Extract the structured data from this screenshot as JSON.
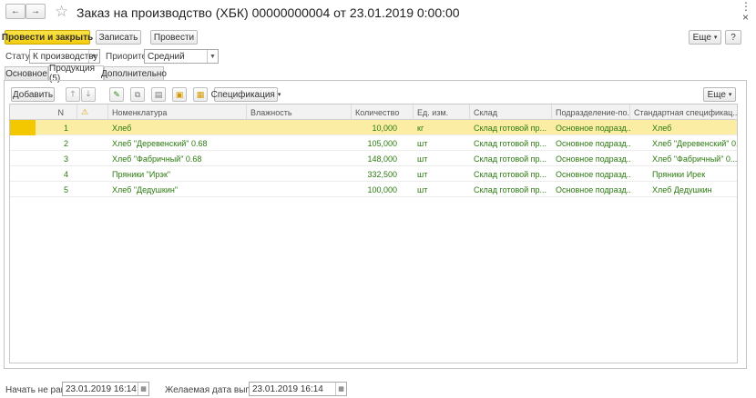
{
  "window": {
    "title": "Заказ на производство (ХБК) 00000000004 от 23.01.2019 0:00:00",
    "more": "⋮",
    "close": "×"
  },
  "nav": {
    "back": "←",
    "forward": "→",
    "star": "☆"
  },
  "toolbar": {
    "post_close": "Провести и закрыть",
    "save": "Записать",
    "post": "Провести",
    "more": "Еще",
    "help": "?"
  },
  "status": {
    "status_label": "Статус:",
    "status_value": "К производству",
    "priority_label": "Приоритет:",
    "priority_value": "Средний"
  },
  "tabs": [
    {
      "label": "Основное"
    },
    {
      "label": "Продукция (5)"
    },
    {
      "label": "Дополнительно"
    }
  ],
  "table_toolbar": {
    "add": "Добавить",
    "spec": "Спецификация",
    "more": "Еще"
  },
  "table": {
    "columns": [
      "N",
      "⚠",
      "Номенклатура",
      "Влажность",
      "Количество",
      "Ед. изм.",
      "Склад",
      "Подразделение-по...",
      "Стандартная спецификац..."
    ],
    "rows": [
      {
        "n": "1",
        "item": "Хлеб",
        "moisture": "",
        "qty": "10,000",
        "unit": "кг",
        "warehouse": "Склад готовой пр...",
        "dept": "Основное подразд...",
        "spec": "Хлеб"
      },
      {
        "n": "2",
        "item": "Хлеб \"Деревенский\" 0.68",
        "moisture": "",
        "qty": "105,000",
        "unit": "шт",
        "warehouse": "Склад готовой пр...",
        "dept": "Основное подразд...",
        "spec": "Хлеб \"Деревенский\" 0.68"
      },
      {
        "n": "3",
        "item": "Хлеб \"Фабричный\" 0.68",
        "moisture": "",
        "qty": "148,000",
        "unit": "шт",
        "warehouse": "Склад готовой пр...",
        "dept": "Основное подразд...",
        "spec": "Хлеб \"Фабричный\" 0...."
      },
      {
        "n": "4",
        "item": "Пряники \"Ирэк\"",
        "moisture": "",
        "qty": "332,500",
        "unit": "шт",
        "warehouse": "Склад готовой пр...",
        "dept": "Основное подразд...",
        "spec": "Пряники Ирек"
      },
      {
        "n": "5",
        "item": "Хлеб \"Дедушкин\"",
        "moisture": "",
        "qty": "100,000",
        "unit": "шт",
        "warehouse": "Склад готовой пр...",
        "dept": "Основное подразд...",
        "spec": "Хлеб Дедушкин"
      }
    ]
  },
  "footer": {
    "start_label": "Начать не ранее:",
    "start_value": "23.01.2019 16:14",
    "release_label": "Желаемая дата выпуска:",
    "release_value": "23.01.2019 16:14"
  }
}
